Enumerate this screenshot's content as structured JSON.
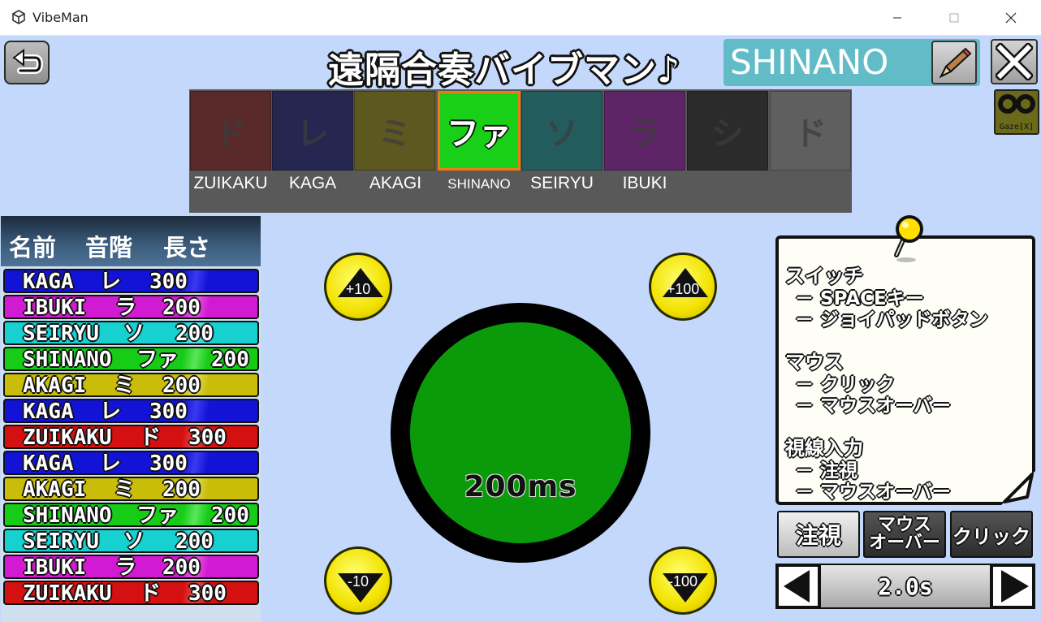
{
  "window": {
    "title": "VibeMan",
    "icon": "unity-icon",
    "controls": [
      "minimize-icon",
      "maximize-icon",
      "close-icon"
    ]
  },
  "header": {
    "back_icon": "undo-arrow-icon",
    "title": "遠隔合奏バイブマン♪",
    "player_name": "SHINANO",
    "edit_icon": "pencil-icon",
    "close_icon": "close-x-icon",
    "gaze_label": "Gaze[X]"
  },
  "notes": [
    {
      "note": "ド",
      "member": "ZUIKAKU",
      "color": "#5a2a2a"
    },
    {
      "note": "レ",
      "member": "KAGA",
      "color": "#252750"
    },
    {
      "note": "ミ",
      "member": "AKAGI",
      "color": "#5c5820"
    },
    {
      "note": "ファ",
      "member": "SHINANO",
      "color": "#18d018",
      "selected": true
    },
    {
      "note": "ソ",
      "member": "SEIRYU",
      "color": "#235c5c"
    },
    {
      "note": "ラ",
      "member": "IBUKI",
      "color": "#5e2566"
    },
    {
      "note": "シ",
      "member": "",
      "color": "#2b2b2b"
    },
    {
      "note": "ド",
      "member": "",
      "color": "#5f5f5f"
    }
  ],
  "sequence": {
    "headers": [
      "名前",
      "音階",
      "長さ"
    ],
    "rows": [
      {
        "name": "KAGA",
        "note": "レ",
        "length": "300",
        "color": "#1313d8"
      },
      {
        "name": "IBUKI",
        "note": "ラ",
        "length": "200",
        "color": "#d31ad3"
      },
      {
        "name": "SEIRYU",
        "note": "ソ",
        "length": "200",
        "color": "#17d0d0"
      },
      {
        "name": "SHINANO",
        "note": "ファ",
        "length": "200",
        "color": "#16cc16"
      },
      {
        "name": "AKAGI",
        "note": "ミ",
        "length": "200",
        "color": "#c9bd09"
      },
      {
        "name": "KAGA",
        "note": "レ",
        "length": "300",
        "color": "#1313d8"
      },
      {
        "name": "ZUIKAKU",
        "note": "ド",
        "length": "300",
        "color": "#d51010"
      },
      {
        "name": "KAGA",
        "note": "レ",
        "length": "300",
        "color": "#1313d8"
      },
      {
        "name": "AKAGI",
        "note": "ミ",
        "length": "200",
        "color": "#c9bd09"
      },
      {
        "name": "SHINANO",
        "note": "ファ",
        "length": "200",
        "color": "#16cc16"
      },
      {
        "name": "SEIRYU",
        "note": "ソ",
        "length": "200",
        "color": "#17d0d0"
      },
      {
        "name": "IBUKI",
        "note": "ラ",
        "length": "200",
        "color": "#d31ad3"
      },
      {
        "name": "ZUIKAKU",
        "note": "ド",
        "length": "300",
        "color": "#d51010"
      }
    ]
  },
  "controls": {
    "plus10": "+10",
    "plus100": "+100",
    "minus10": "-10",
    "minus100": "-100",
    "duration": "200ms",
    "circle_color": "#0a9a0a"
  },
  "help": {
    "lines": [
      "スイッチ",
      "－ SPACEキー",
      "－ ジョイパッドボタン",
      "マウス",
      "－ クリック",
      "－ マウスオーバー",
      "視線入力",
      "－ 注視",
      "－ マウスオーバー"
    ],
    "pin_icon": "pushpin-icon"
  },
  "modes": {
    "gaze": "注視",
    "mouseover_line1": "マウス",
    "mouseover_line2": "オーバー",
    "click": "クリック",
    "selected": "注視"
  },
  "timer": {
    "value": "2.0s",
    "left_icon": "triangle-left-icon",
    "right_icon": "triangle-right-icon"
  }
}
